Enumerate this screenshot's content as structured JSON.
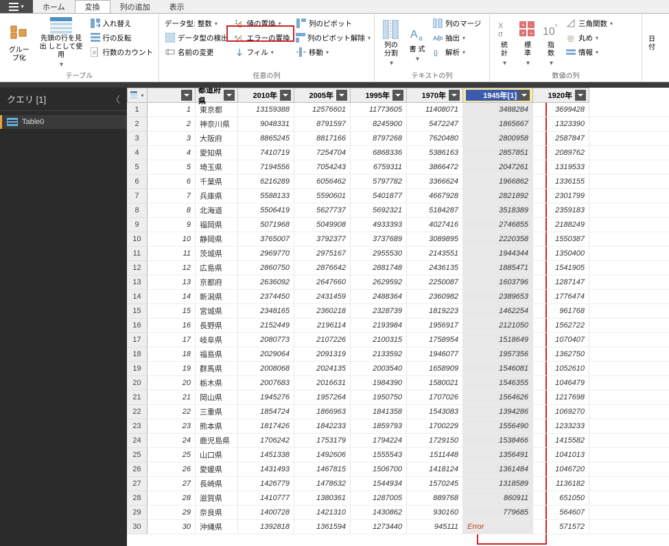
{
  "menu": {
    "home": "ホーム",
    "transform": "変換",
    "addcol": "列の追加",
    "view": "表示"
  },
  "ribbon": {
    "g_table": "テーブル",
    "g_anycol": "任意の列",
    "g_textcol": "テキストの列",
    "g_numcol": "数値の列",
    "group_by": "グルー\nプ化",
    "use_first_row": "先頭の行を見出\nしとして使用",
    "transpose": "入れ替え",
    "reverse": "行の反転",
    "count_rows": "行数のカウント",
    "dtype": "データ型: 整数",
    "detect_dtype": "データ型の検出",
    "rename": "名前の変更",
    "replace_val": "値の置換",
    "replace_err": "エラーの置換",
    "fill": "フィル",
    "pivot": "列のピボット",
    "unpivot": "列のピボット解除",
    "move": "移動",
    "split_col": "列の\n分割",
    "format": "書\n式",
    "merge_col": "列のマージ",
    "extract": "抽出",
    "parse": "解析",
    "stats": "統\n計",
    "standard": "標\n準",
    "exponent": "指\n数",
    "ten": "10",
    "trig": "三角関数",
    "round": "丸め",
    "info": "情報",
    "edge": "日\n付"
  },
  "query": {
    "header": "クエリ",
    "count": "[1]",
    "item0": "Table0"
  },
  "columns": [
    "",
    "都道府県",
    "2010年",
    "2005年",
    "1995年",
    "1970年",
    "1945年[1]",
    "1920年"
  ],
  "rows": [
    {
      "n": 1,
      "i": "1",
      "p": "東京都",
      "d": [
        "13159388",
        "12576601",
        "11773605",
        "11408071",
        "3488284",
        "3699428"
      ]
    },
    {
      "n": 2,
      "i": "2",
      "p": "神奈川県",
      "d": [
        "9048331",
        "8791597",
        "8245900",
        "5472247",
        "1865667",
        "1323390"
      ]
    },
    {
      "n": 3,
      "i": "3",
      "p": "大阪府",
      "d": [
        "8865245",
        "8817166",
        "8797268",
        "7620480",
        "2800958",
        "2587847"
      ]
    },
    {
      "n": 4,
      "i": "4",
      "p": "愛知県",
      "d": [
        "7410719",
        "7254704",
        "6868336",
        "5386163",
        "2857851",
        "2089762"
      ]
    },
    {
      "n": 5,
      "i": "5",
      "p": "埼玉県",
      "d": [
        "7194556",
        "7054243",
        "6759311",
        "3866472",
        "2047261",
        "1319533"
      ]
    },
    {
      "n": 6,
      "i": "6",
      "p": "千葉県",
      "d": [
        "6216289",
        "6056462",
        "5797782",
        "3366624",
        "1966862",
        "1336155"
      ]
    },
    {
      "n": 7,
      "i": "7",
      "p": "兵庫県",
      "d": [
        "5588133",
        "5590601",
        "5401877",
        "4667928",
        "2821892",
        "2301799"
      ]
    },
    {
      "n": 8,
      "i": "8",
      "p": "北海道",
      "d": [
        "5506419",
        "5627737",
        "5692321",
        "5184287",
        "3518389",
        "2359183"
      ]
    },
    {
      "n": 9,
      "i": "9",
      "p": "福岡県",
      "d": [
        "5071968",
        "5049908",
        "4933393",
        "4027416",
        "2746855",
        "2188249"
      ]
    },
    {
      "n": 10,
      "i": "10",
      "p": "静岡県",
      "d": [
        "3765007",
        "3792377",
        "3737689",
        "3089895",
        "2220358",
        "1550387"
      ]
    },
    {
      "n": 11,
      "i": "11",
      "p": "茨城県",
      "d": [
        "2969770",
        "2975167",
        "2955530",
        "2143551",
        "1944344",
        "1350400"
      ]
    },
    {
      "n": 12,
      "i": "12",
      "p": "広島県",
      "d": [
        "2860750",
        "2876642",
        "2881748",
        "2436135",
        "1885471",
        "1541905"
      ]
    },
    {
      "n": 13,
      "i": "13",
      "p": "京都府",
      "d": [
        "2636092",
        "2647660",
        "2629592",
        "2250087",
        "1603796",
        "1287147"
      ]
    },
    {
      "n": 14,
      "i": "14",
      "p": "新潟県",
      "d": [
        "2374450",
        "2431459",
        "2488364",
        "2360982",
        "2389653",
        "1776474"
      ]
    },
    {
      "n": 15,
      "i": "15",
      "p": "宮城県",
      "d": [
        "2348165",
        "2360218",
        "2328739",
        "1819223",
        "1462254",
        "961768"
      ]
    },
    {
      "n": 16,
      "i": "16",
      "p": "長野県",
      "d": [
        "2152449",
        "2196114",
        "2193984",
        "1956917",
        "2121050",
        "1562722"
      ]
    },
    {
      "n": 17,
      "i": "17",
      "p": "岐阜県",
      "d": [
        "2080773",
        "2107226",
        "2100315",
        "1758954",
        "1518649",
        "1070407"
      ]
    },
    {
      "n": 18,
      "i": "18",
      "p": "福島県",
      "d": [
        "2029064",
        "2091319",
        "2133592",
        "1946077",
        "1957356",
        "1362750"
      ]
    },
    {
      "n": 19,
      "i": "19",
      "p": "群馬県",
      "d": [
        "2008068",
        "2024135",
        "2003540",
        "1658909",
        "1546081",
        "1052610"
      ]
    },
    {
      "n": 20,
      "i": "20",
      "p": "栃木県",
      "d": [
        "2007683",
        "2016631",
        "1984390",
        "1580021",
        "1546355",
        "1046479"
      ]
    },
    {
      "n": 21,
      "i": "21",
      "p": "岡山県",
      "d": [
        "1945276",
        "1957264",
        "1950750",
        "1707026",
        "1564626",
        "1217698"
      ]
    },
    {
      "n": 22,
      "i": "22",
      "p": "三重県",
      "d": [
        "1854724",
        "1866963",
        "1841358",
        "1543083",
        "1394286",
        "1069270"
      ]
    },
    {
      "n": 23,
      "i": "23",
      "p": "熊本県",
      "d": [
        "1817426",
        "1842233",
        "1859793",
        "1700229",
        "1556490",
        "1233233"
      ]
    },
    {
      "n": 24,
      "i": "24",
      "p": "鹿児島県",
      "d": [
        "1706242",
        "1753179",
        "1794224",
        "1729150",
        "1538466",
        "1415582"
      ]
    },
    {
      "n": 25,
      "i": "25",
      "p": "山口県",
      "d": [
        "1451338",
        "1492606",
        "1555543",
        "1511448",
        "1356491",
        "1041013"
      ]
    },
    {
      "n": 26,
      "i": "26",
      "p": "愛媛県",
      "d": [
        "1431493",
        "1467815",
        "1506700",
        "1418124",
        "1361484",
        "1046720"
      ]
    },
    {
      "n": 27,
      "i": "27",
      "p": "長崎県",
      "d": [
        "1426779",
        "1478632",
        "1544934",
        "1570245",
        "1318589",
        "1136182"
      ]
    },
    {
      "n": 28,
      "i": "28",
      "p": "滋賀県",
      "d": [
        "1410777",
        "1380361",
        "1287005",
        "889768",
        "860911",
        "651050"
      ]
    },
    {
      "n": 29,
      "i": "29",
      "p": "奈良県",
      "d": [
        "1400728",
        "1421310",
        "1430862",
        "930160",
        "779685",
        "564607"
      ]
    },
    {
      "n": 30,
      "i": "30",
      "p": "沖縄県",
      "d": [
        "1392818",
        "1361594",
        "1273440",
        "945111",
        "Error",
        "571572"
      ]
    }
  ],
  "error_text": "Error"
}
